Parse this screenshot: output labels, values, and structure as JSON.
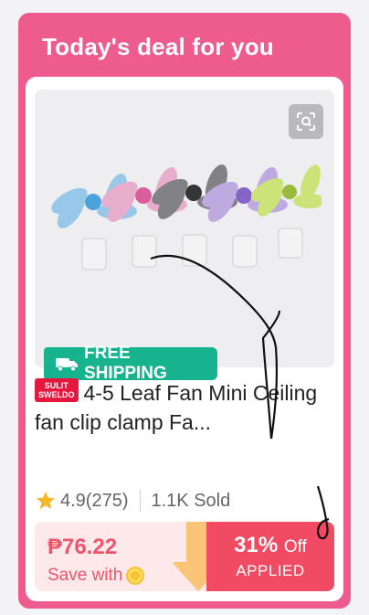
{
  "deal_card": {
    "title": "Today's deal for you",
    "shipping_badge": "FREE SHIPPING",
    "shipping_icon": "truck-icon",
    "brand_badge": {
      "line1": "SULIT",
      "line2": "SWELDO"
    },
    "product_title": "4-5 Leaf Fan Mini Ceiling fan clip clamp Fa...",
    "rating": "4.9(275)",
    "sold": "1.1K Sold",
    "price": "₱76.22",
    "save_with": "Save with",
    "discount_percent": "31%",
    "discount_off": "Off",
    "applied_label": "APPLIED"
  },
  "colors": {
    "card_border": "#ee5b8d",
    "shipping_green": "#17b38e",
    "price_red": "#f0546a",
    "discount_bg": "#f04b62",
    "brand_red": "#e5173c"
  },
  "icons": [
    "scan-icon",
    "truck-icon",
    "star-icon",
    "coin-icon"
  ]
}
